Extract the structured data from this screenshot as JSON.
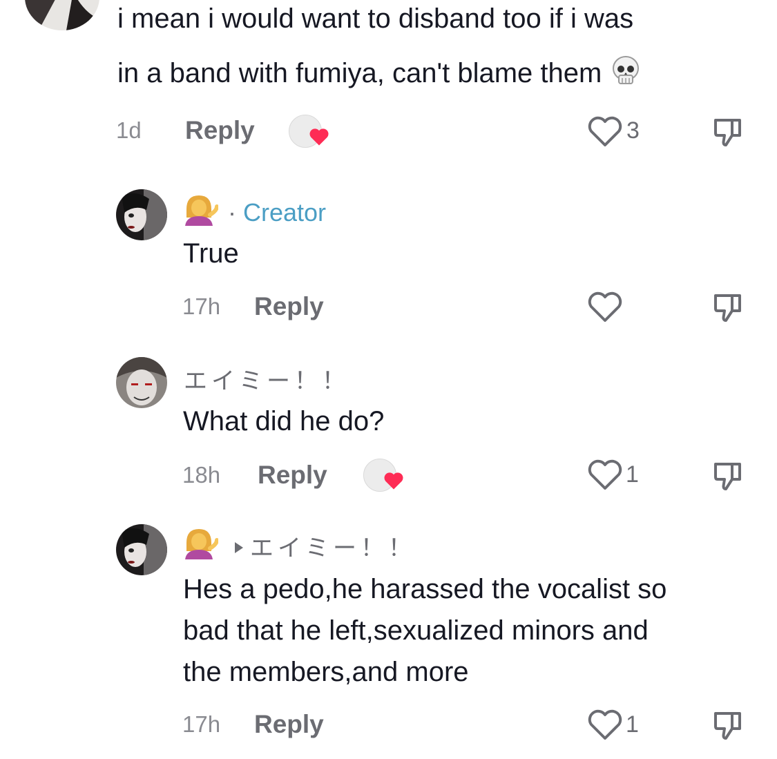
{
  "comments": [
    {
      "text_lines": [
        "i mean i would want to disband too if i was",
        "in a band with fumiya, can't blame them"
      ],
      "trailing_emoji": "skull-emoji",
      "time": "1d",
      "reply_label": "Reply",
      "creator_liked": true,
      "like_count": "3"
    },
    {
      "author_emoji": "person-tipping-hand-emoji",
      "separator": "·",
      "creator_label": "Creator",
      "text": "True",
      "time": "17h",
      "reply_label": "Reply",
      "like_count": ""
    },
    {
      "author": "エイミー！！",
      "text": "What did he do?",
      "time": "18h",
      "reply_label": "Reply",
      "creator_liked": true,
      "like_count": "1"
    },
    {
      "author_emoji": "person-tipping-hand-emoji",
      "reply_to": "エイミー！！",
      "text_lines": [
        "Hes a pedo,he harassed the vocalist so",
        "bad that he left,sexualized minors and",
        "the members,and more"
      ],
      "time": "17h",
      "reply_label": "Reply",
      "like_count": "1"
    }
  ],
  "colors": {
    "creator": "#4b9ec4",
    "like_heart": "#fe2c55",
    "meta": "#8a8b91"
  }
}
